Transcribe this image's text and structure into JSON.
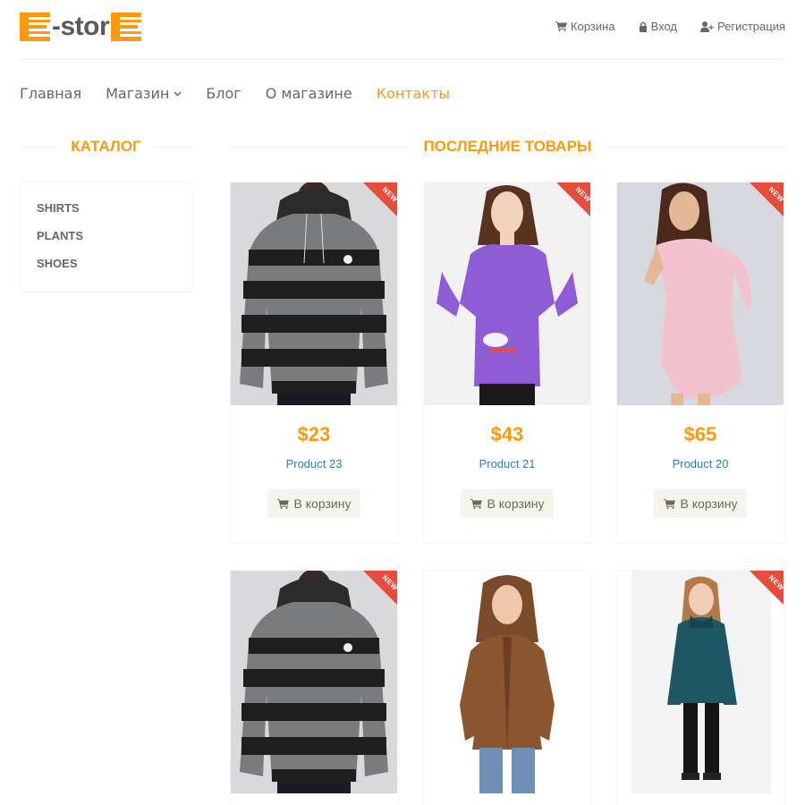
{
  "header": {
    "logo": {
      "prefix_letter": "E",
      "text": "-stor",
      "suffix_letter": "E"
    },
    "links": [
      {
        "label": "Корзина",
        "icon": "cart-icon"
      },
      {
        "label": "Вход",
        "icon": "lock-icon"
      },
      {
        "label": "Регистрация",
        "icon": "user-plus-icon"
      }
    ]
  },
  "nav": [
    {
      "label": "Главная"
    },
    {
      "label": "Магазин",
      "icon": "chevron-down-icon"
    },
    {
      "label": "Блог"
    },
    {
      "label": "О магазине"
    },
    {
      "label": "Контакты",
      "active": true
    }
  ],
  "sidebar": {
    "title": "КАТАЛОГ",
    "categories": [
      "SHIRTS",
      "PLANTS",
      "SHOES"
    ]
  },
  "main": {
    "title": "ПОСЛЕДНИЕ ТОВАРЫ",
    "add_to_cart_label": "В корзину",
    "new_badge": "NEW",
    "products": [
      {
        "price": "$23",
        "name": "Product 23",
        "image": "striped-sweater-man",
        "new": true
      },
      {
        "price": "$43",
        "name": "Product 21",
        "image": "purple-top-woman",
        "new": true
      },
      {
        "price": "$65",
        "name": "Product 20",
        "image": "pink-dress-woman",
        "new": true
      },
      {
        "image": "striped-sweater-man",
        "new": true
      },
      {
        "image": "brown-leather-jacket-woman",
        "new": false
      },
      {
        "image": "teal-coat-woman",
        "new": true
      }
    ]
  },
  "colors": {
    "accent": "#FE980F",
    "link": "#337ab7",
    "badge": "#e74c3c",
    "button_bg": "#F5F5ED"
  }
}
